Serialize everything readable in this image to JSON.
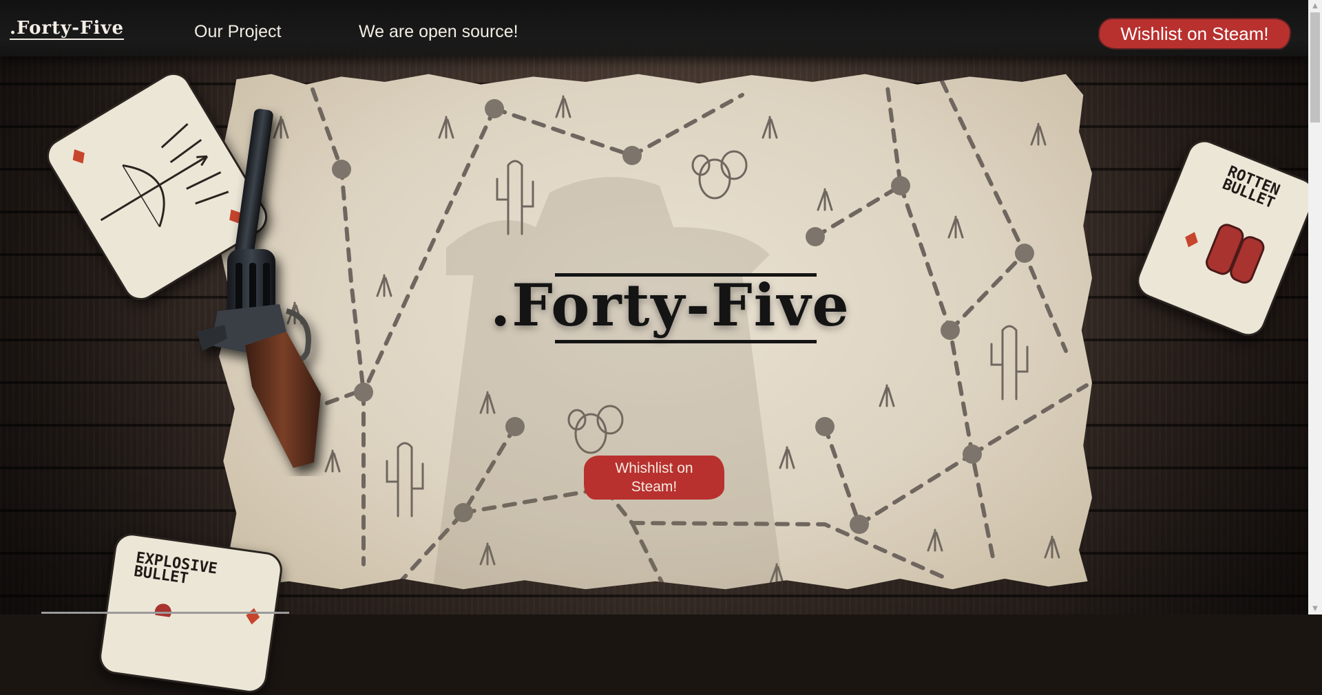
{
  "header": {
    "brand": ".Forty-Five",
    "nav": [
      {
        "label": "Our Project"
      },
      {
        "label": "We are open source!"
      }
    ],
    "cta_label": "Wishlist on Steam!"
  },
  "hero": {
    "logo_text": ".Forty-Five",
    "cta_label": "Whishlist on Steam!",
    "cards": [
      {
        "title": "ROTTEN\nBULLET"
      },
      {
        "title": "EXPLOSIVE\nBULLET"
      }
    ]
  },
  "colors": {
    "accent_red": "#b8312f",
    "nav_bg": "#151515",
    "map_paper": "#e4dbca",
    "map_dots": "#7d756c"
  }
}
